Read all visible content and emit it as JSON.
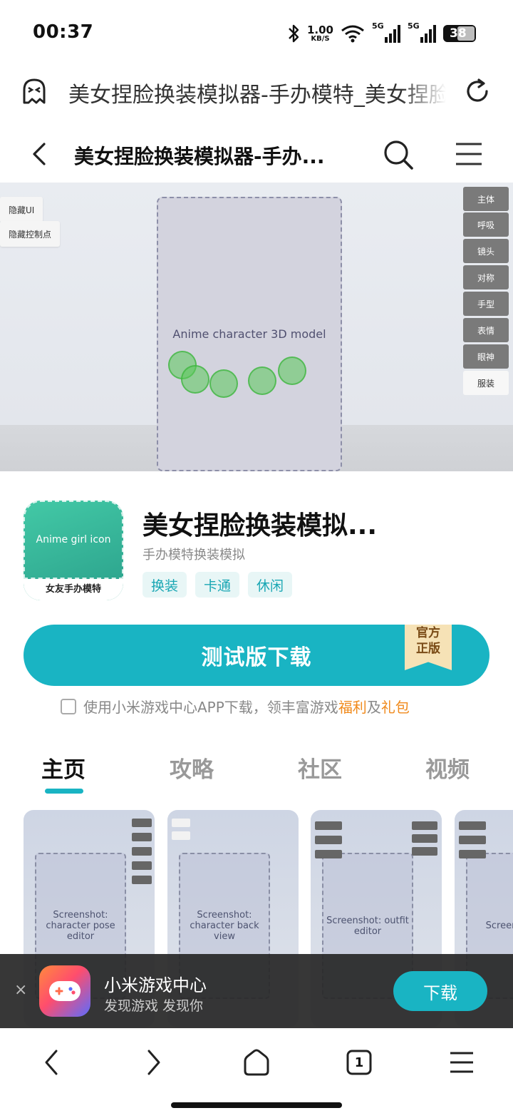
{
  "status_bar": {
    "time": "00:37",
    "net_speed_value": "1.00",
    "net_speed_unit": "KB/S",
    "sim1_label": "5G",
    "sim2_label": "5G",
    "battery": "38"
  },
  "browser": {
    "url_title": "美女捏脸换装模拟器-手办模特_美女捏脸换装模拟器-手办模特下载"
  },
  "header": {
    "title": "美女捏脸换装模拟器-手办..."
  },
  "hero": {
    "hide_ui": "隐藏UI",
    "hide_control_points": "隐藏控制点",
    "side_buttons": [
      "主体",
      "呼吸",
      "镜头",
      "对称",
      "手型",
      "表情",
      "眼神",
      "服装"
    ],
    "image_label": "Anime character 3D model"
  },
  "app": {
    "name": "美女捏脸换装模拟...",
    "subtitle": "手办模特换装模拟",
    "icon_caption": "女友手办模特",
    "icon_image_label": "Anime girl icon",
    "tags": [
      "换装",
      "卡通",
      "休闲"
    ]
  },
  "download": {
    "label": "测试版下载",
    "ribbon_line1": "官方",
    "ribbon_line2": "正版"
  },
  "consent": {
    "text": "使用小米游戏中心APP下载，领丰富游戏",
    "highlight1": "福利",
    "connector": "及",
    "highlight2": "礼包"
  },
  "tabs": [
    "主页",
    "攻略",
    "社区",
    "视频"
  ],
  "gallery": {
    "shot1_label": "Screenshot: character pose editor",
    "shot2_label": "Screenshot: character back view",
    "shot3_label": "Screenshot: outfit editor",
    "shot4_label": "Screenshot"
  },
  "promo": {
    "close": "×",
    "title": "小米游戏中心",
    "subtitle": "发现游戏 发现你",
    "button": "下载"
  },
  "bottom_nav": {
    "tab_count": "1"
  },
  "colors": {
    "accent": "#19b4c3",
    "highlight": "#f08a1c",
    "ribbon": "#f6e2b6"
  }
}
